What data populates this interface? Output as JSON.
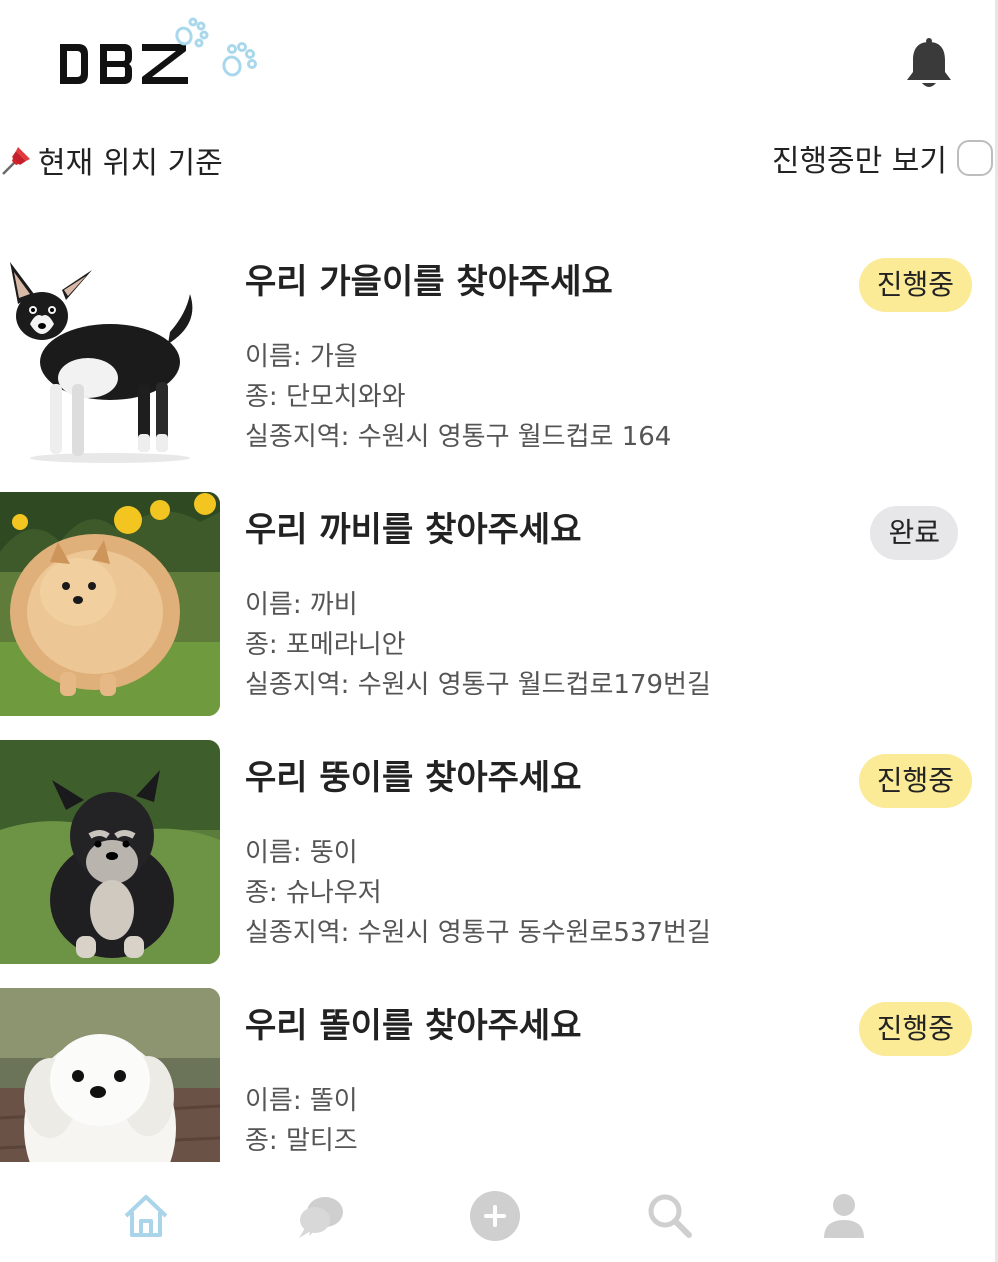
{
  "header": {
    "logo_text": "DBZ",
    "bell_icon": "bell-icon"
  },
  "filters": {
    "location_icon": "pushpin-icon",
    "location_label": "현재 위치 기준",
    "only_active_label": "진행중만 보기",
    "only_active_checked": false
  },
  "posts": [
    {
      "title": "우리 가을이를 찾아주세요",
      "status": "진행중",
      "name": "이름: 가을",
      "breed": "종: 단모치와와",
      "location": "실종지역: 수원시 영통구 월드컵로 164",
      "image": "chihuahua-photo"
    },
    {
      "title": "우리 까비를 찾아주세요",
      "status": "완료",
      "name": "이름: 까비",
      "breed": "종: 포메라니안",
      "location": "실종지역: 수원시 영통구 월드컵로179번길",
      "image": "pomeranian-photo"
    },
    {
      "title": "우리 뚱이를 찾아주세요",
      "status": "진행중",
      "name": "이름: 뚱이",
      "breed": "종: 슈나우저",
      "location": "실종지역: 수원시 영통구 동수원로537번길",
      "image": "schnauzer-photo"
    },
    {
      "title": "우리 똘이를 찾아주세요",
      "status": "진행중",
      "name": "이름: 똘이",
      "breed": "종: 말티즈",
      "location": "",
      "image": "maltese-photo"
    }
  ],
  "nav": {
    "items": [
      "home-icon",
      "chat-icon",
      "add-icon",
      "search-icon",
      "profile-icon"
    ],
    "active": "home-icon"
  },
  "colors": {
    "active_badge": "#fbea96",
    "done_badge": "#e7e7ea",
    "nav_active": "#a9d4ea",
    "nav_inactive": "#cfcfcf",
    "paw": "#a9d8ec"
  }
}
